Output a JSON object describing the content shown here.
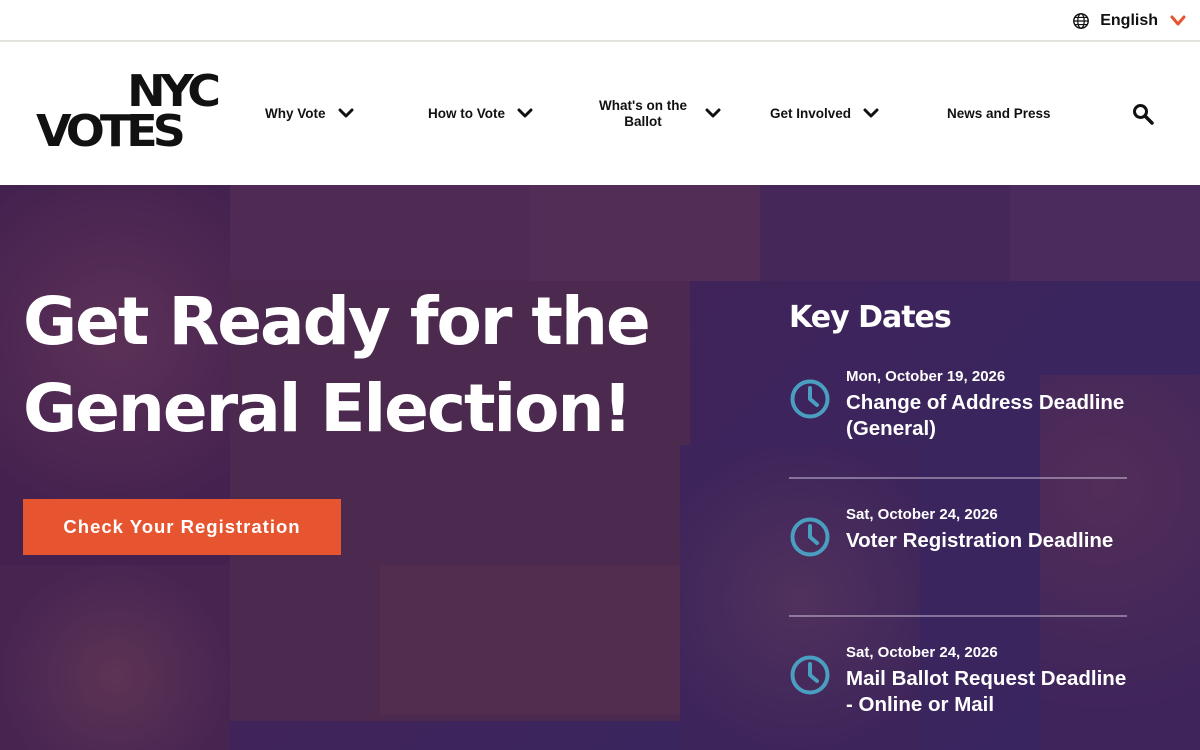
{
  "language": {
    "label": "English",
    "icon": "globe-icon",
    "chevron": "chevron-down-icon",
    "accent": "#e6552f"
  },
  "logo": {
    "line1": "NYC",
    "line2": "VOTES"
  },
  "nav": {
    "items": [
      {
        "label": "Why Vote",
        "has_dropdown": true
      },
      {
        "label": "How to Vote",
        "has_dropdown": true
      },
      {
        "label": "What's on the Ballot",
        "has_dropdown": true
      },
      {
        "label": "Get Involved",
        "has_dropdown": true
      },
      {
        "label": "News and Press",
        "has_dropdown": false
      }
    ],
    "search_icon": "search-icon"
  },
  "hero": {
    "title": "Get Ready for the General Election!",
    "cta_label": "Check Your Registration",
    "cta_color": "#e6552f",
    "overlay_color": "#44285a"
  },
  "key_dates": {
    "title": "Key Dates",
    "clock_color": "#4a9fc0",
    "items": [
      {
        "date": "Mon, October 19, 2026",
        "label": "Change of Address Deadline (General)"
      },
      {
        "date": "Sat, October 24, 2026",
        "label": "Voter Registration Deadline"
      },
      {
        "date": "Sat, October 24, 2026",
        "label": "Mail Ballot Request Deadline - Online or Mail"
      }
    ]
  }
}
